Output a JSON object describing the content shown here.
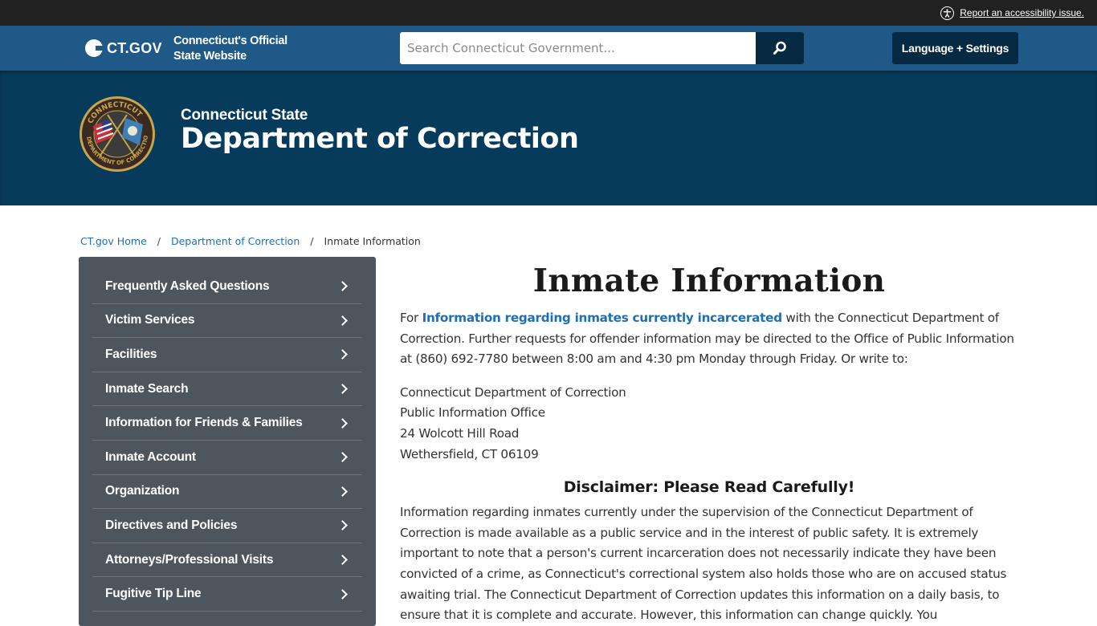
{
  "utility_bar": {
    "accessibility_link": "Report an accessibility issue."
  },
  "global_header": {
    "logo_text": "CT.GOV",
    "tagline_line1": "Connecticut's Official",
    "tagline_line2": "State Website",
    "search_placeholder": "Search Connecticut Government...",
    "search_value": "",
    "language_button": "Language + Settings"
  },
  "agency": {
    "subtitle": "Connecticut State",
    "title": "Department of Correction",
    "seal_top_text": "CONNECTICUT",
    "seal_bottom_text": "DEPARTMENT OF CORRECTION"
  },
  "breadcrumb": [
    {
      "label": "CT.gov Home",
      "link": true
    },
    {
      "label": "Department of Correction",
      "link": true
    },
    {
      "label": "Inmate Information",
      "link": false
    }
  ],
  "sidebar": {
    "items": [
      {
        "label": "Frequently Asked Questions"
      },
      {
        "label": "Victim Services"
      },
      {
        "label": "Facilities"
      },
      {
        "label": "Inmate Search"
      },
      {
        "label": "Information for Friends & Families"
      },
      {
        "label": "Inmate Account"
      },
      {
        "label": "Organization"
      },
      {
        "label": "Directives and Policies"
      },
      {
        "label": "Attorneys/Professional Visits"
      },
      {
        "label": "Fugitive Tip Line"
      }
    ]
  },
  "main": {
    "title": "Inmate Information",
    "intro_prefix": "For ",
    "intro_link": "Information regarding inmates currently incarcerated",
    "intro_suffix": " with the Connecticut Department of Correction. Further requests for offender information may be directed to the Office of Public Information at (860) 692-7780 between 8:00 am and 4:30 pm Monday through Friday.  Or write to:",
    "address": [
      "Connecticut Department of Correction",
      "Public Information Office",
      "24 Wolcott Hill Road",
      "Wethersfield, CT 06109"
    ],
    "disclaimer_title": "Disclaimer: Please Read Carefully!",
    "disclaimer_text": "Information regarding inmates currently under the supervision of the Connecticut Department of Correction is made available as a public service and in the interest of public safety. It is extremely important to note that a person's current incarceration does not necessarily indicate they have been convicted of a crime, as Connecticut's correctional system also holds those who are on accused status awaiting trial. The Connecticut Department of Correction updates this information on a daily basis, to ensure that it is complete and accurate. However, this information can change quickly. You"
  },
  "colors": {
    "utility_bar": "#212121",
    "global_header": "#1f5987",
    "agency_banner": "#063b5c",
    "dark_button": "#052a42",
    "sidebar": "#4e565d",
    "link": "#1f6fb2"
  }
}
